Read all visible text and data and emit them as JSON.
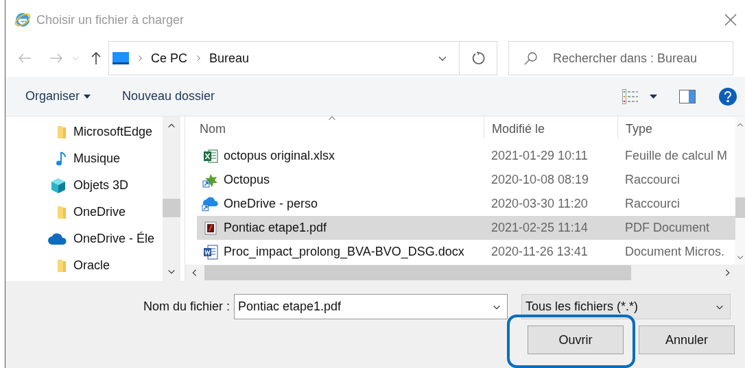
{
  "window": {
    "title": "Choisir un fichier à charger"
  },
  "nav": {
    "path": [
      {
        "label": "Ce PC"
      },
      {
        "label": "Bureau"
      }
    ],
    "search": {
      "placeholder": "Rechercher dans : Bureau"
    }
  },
  "toolbar": {
    "organize": "Organiser",
    "new_folder": "Nouveau dossier"
  },
  "sidebar": {
    "items": [
      {
        "label": "MicrosoftEdge",
        "kind": "folder"
      },
      {
        "label": "Musique",
        "kind": "music"
      },
      {
        "label": "Objets 3D",
        "kind": "cube"
      },
      {
        "label": "OneDrive",
        "kind": "folder"
      },
      {
        "label": "OneDrive - Éle",
        "kind": "cloud"
      },
      {
        "label": "Oracle",
        "kind": "folder"
      }
    ]
  },
  "table": {
    "columns": [
      {
        "label": "Nom",
        "sorted": true
      },
      {
        "label": "Modifié le",
        "sorted": false
      },
      {
        "label": "Type",
        "sorted": false
      }
    ],
    "rows": [
      {
        "kind": "excel",
        "name": "octopus original.xlsx",
        "modified": "2021-01-29 10:11",
        "type": "Feuille de calcul M",
        "selected": false
      },
      {
        "kind": "shortcut",
        "name": "Octopus",
        "modified": "2020-10-08 08:19",
        "type": "Raccourci",
        "selected": false
      },
      {
        "kind": "cloud-shortcut",
        "name": "OneDrive - perso",
        "modified": "2020-03-30 11:20",
        "type": "Raccourci",
        "selected": false
      },
      {
        "kind": "pdf",
        "name": "Pontiac etape1.pdf",
        "modified": "2021-02-25 11:14",
        "type": "PDF Document",
        "selected": true
      },
      {
        "kind": "word",
        "name": "Proc_impact_prolong_BVA-BVO_DSG.docx",
        "modified": "2020-11-26 13:41",
        "type": "Document Micros.",
        "selected": false
      }
    ]
  },
  "footer": {
    "filename_label": "Nom du fichier :",
    "filename": "Pontiac etape1.pdf",
    "filetype": "Tous les fichiers (*.*)",
    "buttons": [
      {
        "label": "Ouvrir",
        "highlighted": true
      },
      {
        "label": "Annuler",
        "highlighted": false
      }
    ]
  }
}
